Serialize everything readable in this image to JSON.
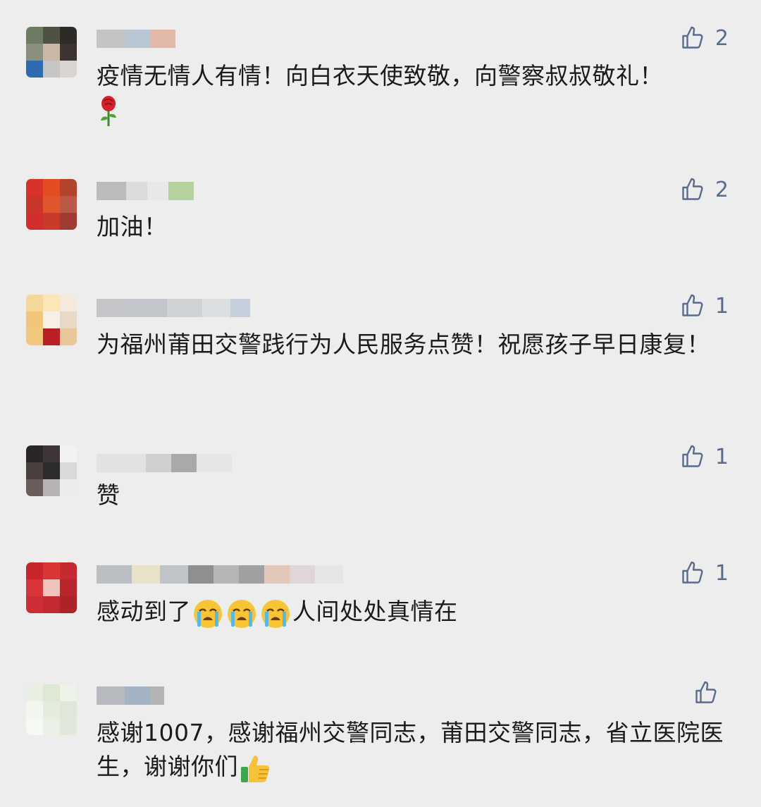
{
  "comments": [
    {
      "likes": "2",
      "text": "疫情无情人有情！向白衣天使致敬，向警察叔叔敬礼！",
      "emoji_after": "rose"
    },
    {
      "likes": "2",
      "text": "加油！"
    },
    {
      "likes": "1",
      "text": "为福州莆田交警践行为人民服务点赞！祝愿孩子早日康复！"
    },
    {
      "likes": "1",
      "text": "赞"
    },
    {
      "likes": "1",
      "text_before": "感动到了",
      "text_after": "人间处处真情在",
      "emoji_mid": "loudly-crying-face"
    },
    {
      "likes": "",
      "text": "感谢1007，感谢福州交警同志，莆田交警同志，省立医院医生，谢谢你们",
      "emoji_after": "thumbs-up"
    }
  ],
  "icons": {
    "like": "thumbs-up-outline-icon"
  },
  "colors": {
    "background": "#ededed",
    "like_icon": "#5a6b8c",
    "text": "#1b1b1b"
  }
}
